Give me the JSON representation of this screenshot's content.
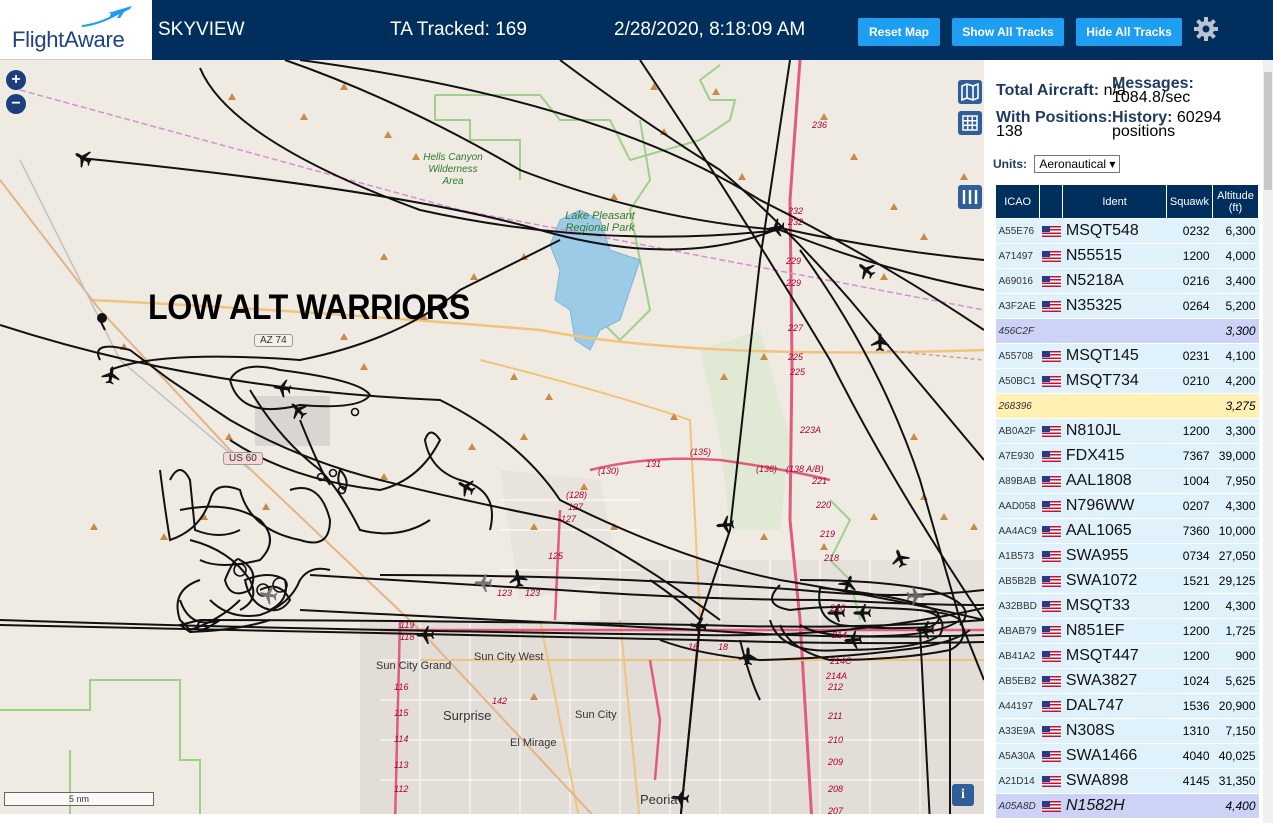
{
  "header": {
    "logo": "FlightAware",
    "app_name": "SKYVIEW",
    "tracked": "TA Tracked: 169",
    "datetime": "2/28/2020, 8:18:09 AM",
    "buttons": {
      "reset": "Reset Map",
      "show_all": "Show All Tracks",
      "hide_all": "Hide All Tracks"
    }
  },
  "map": {
    "zoom_in": "+",
    "zoom_out": "−",
    "annotation": "LOW ALT WARRIORS",
    "scale_label": "5 nm",
    "info_label": "i",
    "shields": [
      "AZ 74",
      "US 60"
    ],
    "places": {
      "sun_city_grand": "Sun City Grand",
      "sun_city_west": "Sun City West",
      "surprise": "Surprise",
      "sun_city": "Sun City",
      "el_mirage": "El Mirage",
      "peoria": "Peoria",
      "hells_canyon": "Hells Canyon Wilderness Area",
      "lake_pleasant": "Lake Pleasant Regional Park"
    },
    "road_labels": {
      "r236": "236",
      "r232a": "232",
      "r232b": "232",
      "r229a": "229",
      "r229b": "229",
      "r227": "227",
      "r225a": "225",
      "r225b": "225",
      "r223a": "223A",
      "r221": "221",
      "r220": "220",
      "r219": "219",
      "r218": "218",
      "r216": "216",
      "r214": "214",
      "r214c": "214C",
      "r214a": "214A",
      "r212": "212",
      "r211": "211",
      "r210": "210",
      "r209": "209",
      "r208": "208",
      "r207": "207",
      "r130": "(130)",
      "r131": "131",
      "r135": "(135)",
      "r136": "(136)",
      "r138": "(138 A/B)",
      "r128": "(128)",
      "r127a": "127",
      "r127b": "127",
      "r125": "125",
      "r123a": "123",
      "r123b": "123",
      "r119": "119",
      "r118": "118",
      "r116": "116",
      "r115": "115",
      "r114": "114",
      "r113": "113",
      "r112": "112",
      "r142": "142",
      "r16": "16",
      "r18": "18"
    }
  },
  "panel": {
    "total_label": "Total Aircraft:",
    "total_value": "n/a",
    "messages_label": "Messages:",
    "messages_value": "1084.8/sec",
    "positions_label": "With Positions:",
    "positions_value": "138",
    "history_label": "History:",
    "history_value": "60294",
    "history_unit": "positions",
    "units_label": "Units:",
    "units_value": "Aeronautical",
    "columns": {
      "icao": "ICAO",
      "ident": "Ident",
      "squawk": "Squawk",
      "altitude": "Altitude (ft)"
    },
    "rows": [
      {
        "icao": "A55E76",
        "ident": "MSQT548",
        "squawk": "0232",
        "altitude": "6,300",
        "flag": true,
        "state": ""
      },
      {
        "icao": "A71497",
        "ident": "N55515",
        "squawk": "1200",
        "altitude": "4,000",
        "flag": true,
        "state": ""
      },
      {
        "icao": "A69016",
        "ident": "N5218A",
        "squawk": "0216",
        "altitude": "3,400",
        "flag": true,
        "state": ""
      },
      {
        "icao": "A3F2AE",
        "ident": "N35325",
        "squawk": "0264",
        "altitude": "5,200",
        "flag": true,
        "state": ""
      },
      {
        "icao": "456C2F",
        "ident": "",
        "squawk": "",
        "altitude": "3,300",
        "flag": false,
        "state": "ghost"
      },
      {
        "icao": "A55708",
        "ident": "MSQT145",
        "squawk": "0231",
        "altitude": "4,100",
        "flag": true,
        "state": ""
      },
      {
        "icao": "A50BC1",
        "ident": "MSQT734",
        "squawk": "0210",
        "altitude": "4,200",
        "flag": true,
        "state": ""
      },
      {
        "icao": "268396",
        "ident": "",
        "squawk": "",
        "altitude": "3,275",
        "flag": false,
        "state": "sel"
      },
      {
        "icao": "AB0A2F",
        "ident": "N810JL",
        "squawk": "1200",
        "altitude": "3,300",
        "flag": true,
        "state": ""
      },
      {
        "icao": "A7E930",
        "ident": "FDX415",
        "squawk": "7367",
        "altitude": "39,000",
        "flag": true,
        "state": ""
      },
      {
        "icao": "A89BAB",
        "ident": "AAL1808",
        "squawk": "1004",
        "altitude": "7,950",
        "flag": true,
        "state": ""
      },
      {
        "icao": "AAD058",
        "ident": "N796WW",
        "squawk": "0207",
        "altitude": "4,300",
        "flag": true,
        "state": ""
      },
      {
        "icao": "AA4AC9",
        "ident": "AAL1065",
        "squawk": "7360",
        "altitude": "10,000",
        "flag": true,
        "state": ""
      },
      {
        "icao": "A1B573",
        "ident": "SWA955",
        "squawk": "0734",
        "altitude": "27,050",
        "flag": true,
        "state": ""
      },
      {
        "icao": "AB5B2B",
        "ident": "SWA1072",
        "squawk": "1521",
        "altitude": "29,125",
        "flag": true,
        "state": ""
      },
      {
        "icao": "A32BBD",
        "ident": "MSQT33",
        "squawk": "1200",
        "altitude": "4,300",
        "flag": true,
        "state": ""
      },
      {
        "icao": "ABAB79",
        "ident": "N851EF",
        "squawk": "1200",
        "altitude": "1,725",
        "flag": true,
        "state": ""
      },
      {
        "icao": "AB41A2",
        "ident": "MSQT447",
        "squawk": "1200",
        "altitude": "900",
        "flag": true,
        "state": ""
      },
      {
        "icao": "AB5EB2",
        "ident": "SWA3827",
        "squawk": "1024",
        "altitude": "5,625",
        "flag": true,
        "state": ""
      },
      {
        "icao": "A44197",
        "ident": "DAL747",
        "squawk": "1536",
        "altitude": "20,900",
        "flag": true,
        "state": ""
      },
      {
        "icao": "A33E9A",
        "ident": "N308S",
        "squawk": "1310",
        "altitude": "7,150",
        "flag": true,
        "state": ""
      },
      {
        "icao": "A5A30A",
        "ident": "SWA1466",
        "squawk": "4040",
        "altitude": "40,025",
        "flag": true,
        "state": ""
      },
      {
        "icao": "A21D14",
        "ident": "SWA898",
        "squawk": "4145",
        "altitude": "31,350",
        "flag": true,
        "state": ""
      },
      {
        "icao": "A05A8D",
        "ident": "N1582H",
        "squawk": "",
        "altitude": "4,400",
        "flag": true,
        "state": "ghost"
      }
    ]
  },
  "colors": {
    "header_bg": "#002f5d",
    "button_bg": "#1d9ef0",
    "row_bg": "#dff1fb",
    "ghost_bg": "#ccd3f7",
    "selected_bg": "#fff1b3",
    "map_bg": "#efebe2",
    "water": "#9ccbe8"
  }
}
